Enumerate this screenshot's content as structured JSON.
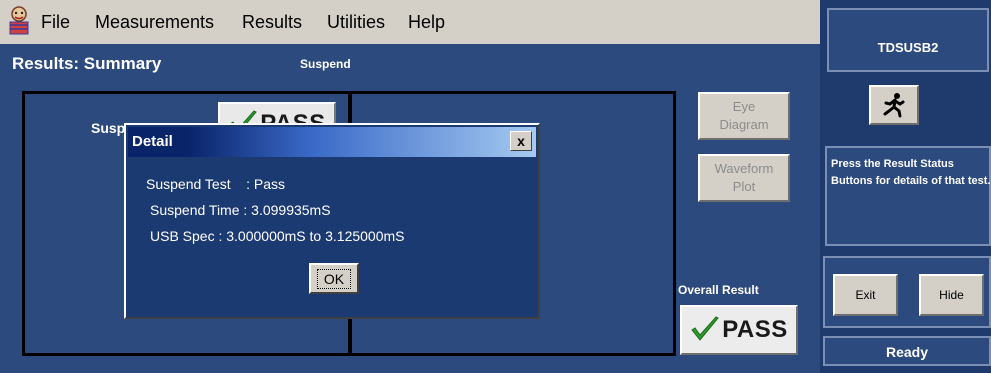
{
  "menubar": {
    "items": [
      "File",
      "Measurements",
      "Results",
      "Utilities",
      "Help"
    ],
    "app_icon": "tektronix-app-icon"
  },
  "main": {
    "title": "Results: Summary",
    "test_name": "Suspend",
    "row_label": "Suspend Test",
    "row_result": "PASS",
    "eye_button": "Eye\nDiagram",
    "waveform_button": "Waveform\nPlot",
    "overall_label": "Overall Result",
    "overall_result": "PASS"
  },
  "right_panel": {
    "title": "TDSUSB2",
    "run_icon": "running-man-icon",
    "info": "Press the Result Status Buttons for details of that test.",
    "exit_label": "Exit",
    "hide_label": "Hide",
    "status": "Ready"
  },
  "dialog": {
    "title": "Detail",
    "close_label": "x",
    "line1": "Suspend Test    : Pass",
    "line2": "Suspend Time : 3.099935mS",
    "line3": "USB Spec : 3.000000mS to 3.125000mS",
    "ok_label": "OK"
  },
  "colors": {
    "panel_blue": "#2c4a7e",
    "right_panel_blue": "#1f3a6d",
    "pass_check_green": "#2e9a2e"
  }
}
